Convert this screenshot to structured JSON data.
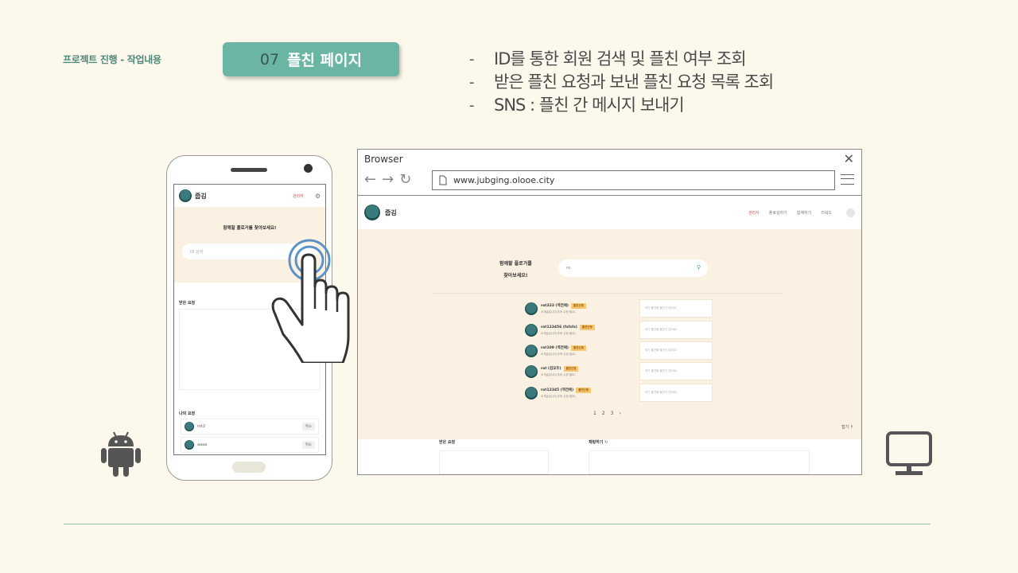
{
  "slide": {
    "section_label": "프로젝트 진행 - 작업내용",
    "title_number": "07",
    "title_text": "플친 페이지",
    "bullets": [
      "ID를 통한 회원 검색 및 플친 여부 조회",
      "받은 플친 요청과 보낸 플친 요청 목록 조회",
      "SNS : 플친 간 메시지 보내기"
    ],
    "bullet_marker": "-"
  },
  "mobile": {
    "logo_text": "줍깅",
    "admin_label": "관리자",
    "lead": "함께할 플로거를 찾아보세요!",
    "search_placeholder": "ID 검색",
    "received_label": "받은 요청",
    "sent_label": "나의 요청",
    "sent_rows": [
      {
        "name": "rot2",
        "action": "취소"
      },
      {
        "name": "aaaa",
        "action": "취소"
      }
    ]
  },
  "browser": {
    "window_title": "Browser",
    "url": "www.jubging.olooe.city",
    "page": {
      "logo_text": "줍깅",
      "nav": [
        "관리자",
        "플로깅하기",
        "함께하기",
        "리워드"
      ],
      "active_nav": "관리자",
      "lead_line1": "함께할 플로거를",
      "lead_line2": "찾아보세요!",
      "search_value": "ro",
      "results": [
        {
          "id": "rot323 (역전에)",
          "tag": "플친신청",
          "sub": "소개글입니다(추후 수정 필요)",
          "msg": "여기 플친할 플친이 있어요!"
        },
        {
          "id": "rot123456 (fsfsfs)",
          "tag": "플친신청",
          "sub": "소개글입니다(추후 수정 필요)",
          "msg": "여기 플친할 플친이 있어요!"
        },
        {
          "id": "rot109 (역전에)",
          "tag": "플친신청",
          "sub": "소개글입니다(추후 수정 필요)",
          "msg": "여기 플친할 플친이 있어요!"
        },
        {
          "id": "rot (김모두)",
          "tag": "플친신청",
          "sub": "소개글입니다(추후 수정 필요)",
          "msg": "여기 플친할 플친이 있어요!"
        },
        {
          "id": "rot12345 (역전에)",
          "tag": "플친신청",
          "sub": "소개글입니다(추후 수정 필요)",
          "msg": "여기 플친할 플친이 있어요!"
        }
      ],
      "pages": [
        "1",
        "2",
        "3",
        "›"
      ],
      "fold_label": "접기 ↑",
      "received_label": "받은 요청",
      "chat_label": "채팅하기"
    }
  },
  "colors": {
    "background": "#fdf8ec",
    "accent": "#6bb5a5",
    "hero": "#fbf1e3",
    "tag": "#f7c873"
  }
}
